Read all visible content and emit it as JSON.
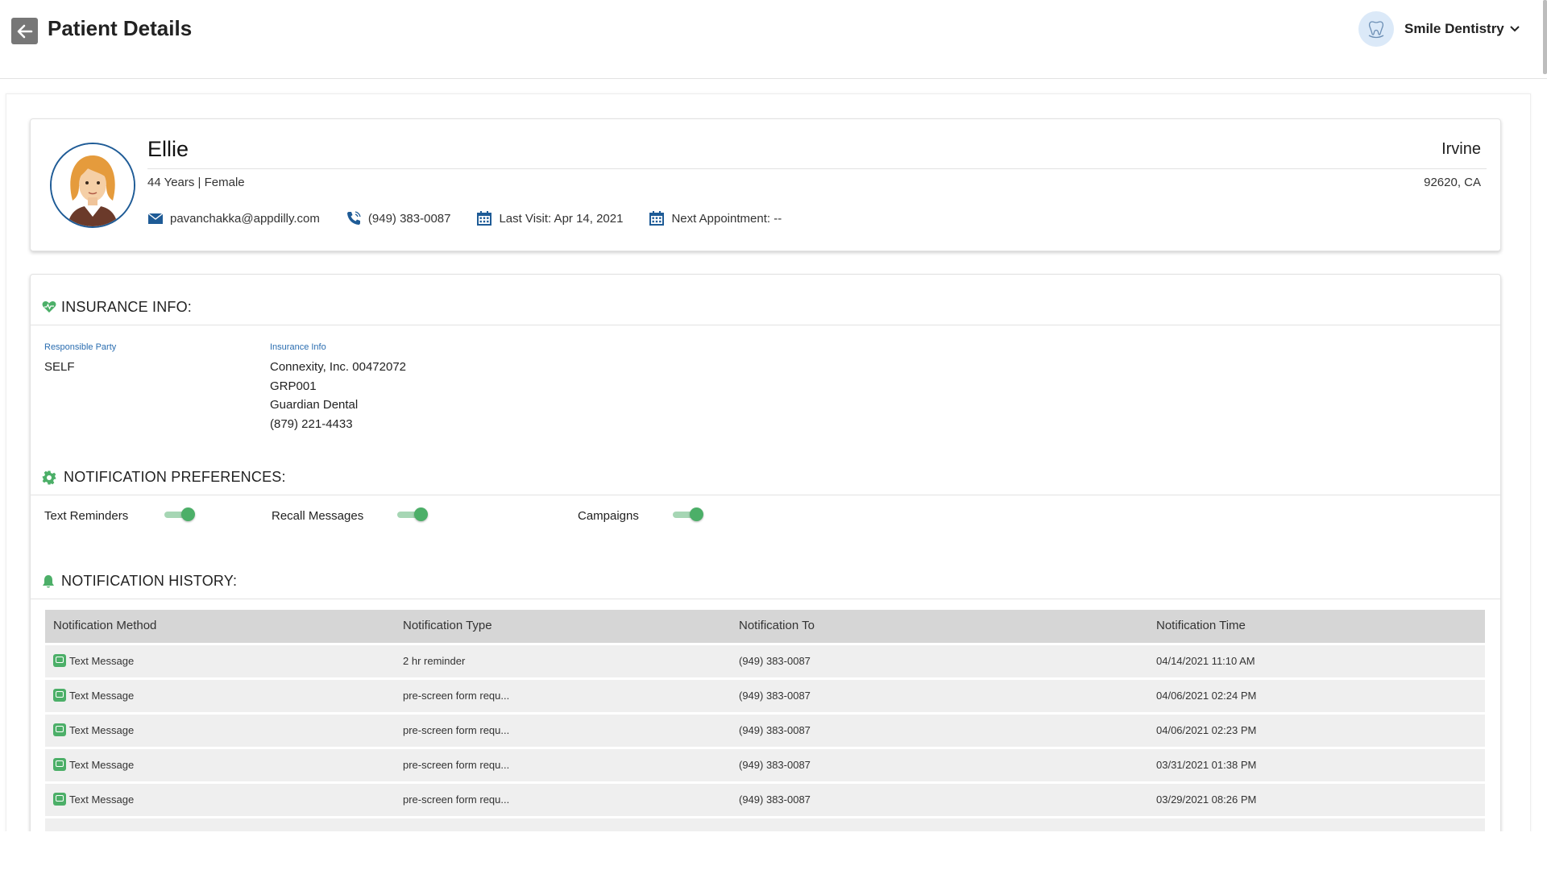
{
  "header": {
    "title": "Patient Details",
    "practice_name": "Smile Dentistry"
  },
  "patient": {
    "name": "Ellie",
    "age_gender": "44 Years | Female",
    "city": "Irvine",
    "zip_state": "92620, CA",
    "email": "pavanchakka@appdilly.com",
    "phone": "(949) 383-0087",
    "last_visit": "Last Visit: Apr 14, 2021",
    "next_appointment": "Next Appointment: --"
  },
  "insurance": {
    "section_title": "INSURANCE INFO:",
    "responsible_party_label": "Responsible Party",
    "responsible_party_value": "SELF",
    "insurance_info_label": "Insurance Info",
    "lines": [
      "Connexity, Inc. 00472072",
      "GRP001",
      "Guardian Dental",
      "(879) 221-4433"
    ]
  },
  "preferences": {
    "section_title": "NOTIFICATION PREFERENCES:",
    "toggles": [
      {
        "label": "Text Reminders",
        "on": true
      },
      {
        "label": "Recall Messages",
        "on": true
      },
      {
        "label": "Campaigns",
        "on": true
      }
    ]
  },
  "history": {
    "section_title": "NOTIFICATION HISTORY:",
    "columns": [
      "Notification Method",
      "Notification Type",
      "Notification To",
      "Notification Time"
    ],
    "rows": [
      [
        "Text Message",
        "2 hr reminder",
        "(949) 383-0087",
        "04/14/2021 11:10 AM"
      ],
      [
        "Text Message",
        "pre-screen form requ...",
        "(949) 383-0087",
        "04/06/2021 02:24 PM"
      ],
      [
        "Text Message",
        "pre-screen form requ...",
        "(949) 383-0087",
        "04/06/2021 02:23 PM"
      ],
      [
        "Text Message",
        "pre-screen form requ...",
        "(949) 383-0087",
        "03/31/2021 01:38 PM"
      ],
      [
        "Text Message",
        "pre-screen form requ...",
        "(949) 383-0087",
        "03/29/2021 08:26 PM"
      ]
    ]
  },
  "colors": {
    "accent_green": "#4caf68",
    "link_blue": "#2a6db0",
    "avatar_border": "#1e5b96"
  },
  "icons": [
    "back-arrow-icon",
    "tooth-logo-icon",
    "chevron-down-icon",
    "mail-icon",
    "phone-icon",
    "calendar-icon",
    "heart-icon",
    "gear-icon",
    "bell-icon",
    "message-icon"
  ]
}
